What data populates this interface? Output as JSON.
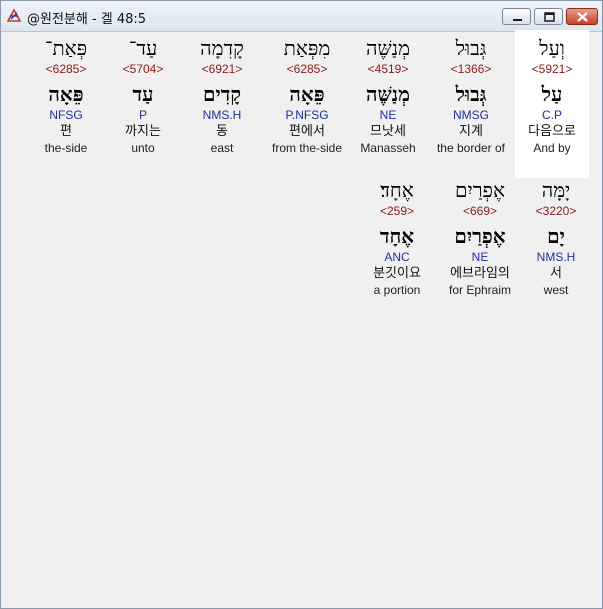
{
  "window": {
    "title": "@원전분해 - 겔 48:5"
  },
  "rows": [
    {
      "words": [
        {
          "hebrew": "וְעַל",
          "strong": "<5921>",
          "lemma": "עַל",
          "morph": "C.P",
          "korean": "다음으로",
          "english": "And by",
          "selected": true
        },
        {
          "hebrew": "גְּבוּל",
          "strong": "<1366>",
          "lemma": "גְּבוּל",
          "morph": "NMSG",
          "korean": "지계",
          "english": "the border of",
          "selected": false
        },
        {
          "hebrew": "מְנַשֶּׁה",
          "strong": "<4519>",
          "lemma": "מְנַשֶּׁה",
          "morph": "NE",
          "korean": "므낫세",
          "english": "Manasseh",
          "selected": false
        },
        {
          "hebrew": "מִפְּאַת",
          "strong": "<6285>",
          "lemma": "פֵּאָה",
          "morph": "P.NFSG",
          "korean": "편에서",
          "english": "from the-side",
          "selected": false
        },
        {
          "hebrew": "קָדִמָה",
          "strong": "<6921>",
          "lemma": "קָדִים",
          "morph": "NMS.H",
          "korean": "동",
          "english": "east",
          "selected": false
        },
        {
          "hebrew": "עַד־",
          "strong": "<5704>",
          "lemma": "עַד",
          "morph": "P",
          "korean": "까지는",
          "english": "unto",
          "selected": false
        },
        {
          "hebrew": "פְּאַת־",
          "strong": "<6285>",
          "lemma": "פֵּאָה",
          "morph": "NFSG",
          "korean": "편",
          "english": "the-side",
          "selected": false
        }
      ]
    },
    {
      "words": [
        {
          "hebrew": "יָמָּה",
          "strong": "<3220>",
          "lemma": "יָם",
          "morph": "NMS.H",
          "korean": "서",
          "english": "west",
          "selected": false
        },
        {
          "hebrew": "אֶפְרַיִם",
          "strong": "<669>",
          "lemma": "אֶפְרַיִם",
          "morph": "NE",
          "korean": "에브라임의",
          "english": "for Ephraim",
          "selected": false
        },
        {
          "hebrew": "אֶחָד׃",
          "strong": "<259>",
          "lemma": "אֶחָד",
          "morph": "ANC",
          "korean": "분깃이요",
          "english": "a portion",
          "selected": false
        }
      ]
    }
  ],
  "colors": {
    "strong": "#8b1a1a",
    "morph": "#1f2fa0",
    "selected_bg": "#ffffff"
  },
  "icons": [
    "app-icon",
    "minimize-icon",
    "maximize-icon",
    "close-icon"
  ]
}
